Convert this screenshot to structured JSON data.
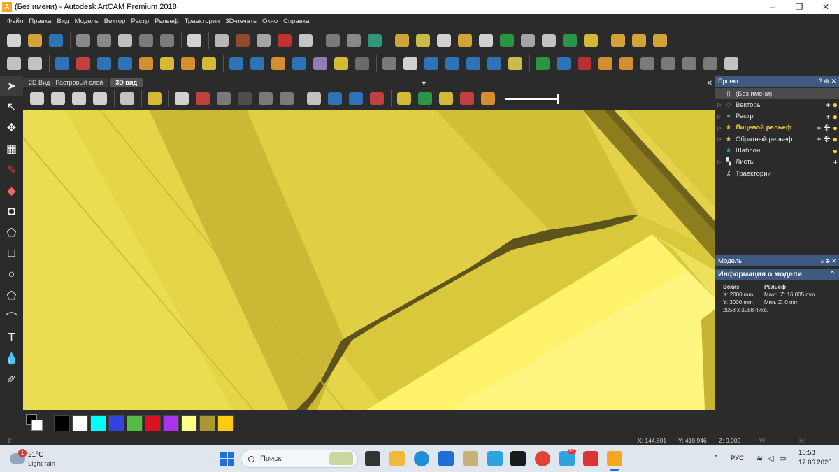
{
  "window": {
    "app_icon_letter": "A",
    "title": "(Без имени) - Autodesk ArtCAM Premium 2018",
    "controls": [
      "minimize-icon",
      "maximize-icon",
      "close-icon"
    ],
    "min_glyph": "–",
    "max_glyph": "❐",
    "close_glyph": "✕"
  },
  "menu": [
    "Файл",
    "Правка",
    "Вид",
    "Модель",
    "Вектор",
    "Растр",
    "Рельеф",
    "Траектория",
    "3D-печать",
    "Окно",
    "Справка"
  ],
  "toolbar1": {
    "icons": [
      {
        "name": "new-file-icon",
        "color": "#f2f2f2"
      },
      {
        "name": "open-folder-icon",
        "color": "#f0b93a"
      },
      {
        "name": "save-icon",
        "color": "#2f7fd0"
      },
      {
        "name": "sep"
      },
      {
        "name": "cut-icon",
        "color": "#9a9a9a"
      },
      {
        "name": "copy-icon",
        "color": "#9a9a9a"
      },
      {
        "name": "paste-icon",
        "color": "#d9d9d9"
      },
      {
        "name": "undo-icon",
        "color": "#8a8a8a"
      },
      {
        "name": "redo-icon",
        "color": "#8a8a8a"
      },
      {
        "name": "sep"
      },
      {
        "name": "notes-icon",
        "color": "#f0f0f0"
      },
      {
        "name": "sep"
      },
      {
        "name": "dimension-icon",
        "color": "#d0d0d0"
      },
      {
        "name": "layers-icon",
        "color": "#a0522d"
      },
      {
        "name": "grid-icon",
        "color": "#bbbbbb"
      },
      {
        "name": "flag-icon",
        "color": "#d33"
      },
      {
        "name": "measure-icon",
        "color": "#e0e0e0"
      },
      {
        "name": "sep"
      },
      {
        "name": "node-edit-icon",
        "color": "#888"
      },
      {
        "name": "transform-icon",
        "color": "#999"
      },
      {
        "name": "color-select-icon",
        "color": "#3a8"
      },
      {
        "name": "sep"
      },
      {
        "name": "folder-star-icon",
        "color": "#f0b93a"
      },
      {
        "name": "chevron-right-icon",
        "color": "#e8d44d"
      },
      {
        "name": "spark-icon",
        "color": "#eee"
      },
      {
        "name": "curve-icon",
        "color": "#f0b93a"
      },
      {
        "name": "star-burst-icon",
        "color": "#eee"
      },
      {
        "name": "relief-green-icon",
        "color": "#2aa84a"
      },
      {
        "name": "relief-stack-icon",
        "color": "#bbb"
      },
      {
        "name": "frame-icon",
        "color": "#ddd"
      },
      {
        "name": "green-grid-icon",
        "color": "#2aa84a"
      },
      {
        "name": "yellow-stack-icon",
        "color": "#f2d23a"
      },
      {
        "name": "sep"
      },
      {
        "name": "vector-dots-icon",
        "color": "#f0b93a"
      },
      {
        "name": "dashed-line-icon",
        "color": "#f0b93a"
      },
      {
        "name": "polyline-icon",
        "color": "#f0b93a"
      }
    ]
  },
  "toolbar2": {
    "icons": [
      {
        "name": "snap-icon",
        "color": "#ddd"
      },
      {
        "name": "target-icon",
        "color": "#ddd"
      },
      {
        "name": "sep"
      },
      {
        "name": "blue-diamond-icon",
        "color": "#2f7fd0"
      },
      {
        "name": "red-pill-icon",
        "color": "#d44"
      },
      {
        "name": "blue-extrude-icon",
        "color": "#2f7fd0"
      },
      {
        "name": "blue-spin-icon",
        "color": "#2f7fd0"
      },
      {
        "name": "waffle-icon",
        "color": "#f0a030"
      },
      {
        "name": "yellow-block-icon",
        "color": "#f2d23a"
      },
      {
        "name": "orange-block-icon",
        "color": "#f0a030"
      },
      {
        "name": "star-shape-icon",
        "color": "#f2d23a"
      },
      {
        "name": "sep"
      },
      {
        "name": "blue-plate-icon",
        "color": "#2f7fd0"
      },
      {
        "name": "blue-split-icon",
        "color": "#2f7fd0"
      },
      {
        "name": "stripe-icon",
        "color": "#f0a030"
      },
      {
        "name": "blue-up-icon",
        "color": "#2f7fd0"
      },
      {
        "name": "purple-stack-icon",
        "color": "#a38bd0"
      },
      {
        "name": "yellow-down-icon",
        "color": "#f2d23a"
      },
      {
        "name": "gray-tilt-icon",
        "color": "#777"
      },
      {
        "name": "sep"
      },
      {
        "name": "tool-icon",
        "color": "#888"
      },
      {
        "name": "white-tilt-icon",
        "color": "#eee"
      },
      {
        "name": "blue-stack-icon",
        "color": "#2f7fd0"
      },
      {
        "name": "blue-flat-icon",
        "color": "#2f7fd0"
      },
      {
        "name": "blue-drill-icon",
        "color": "#2f7fd0"
      },
      {
        "name": "blue-bowl-icon",
        "color": "#2f7fd0"
      },
      {
        "name": "book-stack-icon",
        "color": "#e8d44d"
      },
      {
        "name": "sep"
      },
      {
        "name": "plus-green-icon",
        "color": "#2aa84a"
      },
      {
        "name": "blue-pot-icon",
        "color": "#2f7fd0"
      },
      {
        "name": "red-ring-icon",
        "color": "#c33"
      },
      {
        "name": "merge-arrow-icon",
        "color": "#f0a030"
      },
      {
        "name": "half-shape-icon",
        "color": "#f0a030"
      },
      {
        "name": "dotted-square-icon",
        "color": "#888"
      },
      {
        "name": "dotted-corner-icon",
        "color": "#888"
      },
      {
        "name": "fillet-icon",
        "color": "#888"
      },
      {
        "name": "round-rect-icon",
        "color": "#888"
      },
      {
        "name": "dot-square-icon",
        "color": "#ddd"
      }
    ]
  },
  "view": {
    "tabs": [
      "2D Вид - Растровый слой",
      "3D вид"
    ],
    "active_tab": "3D вид",
    "pin_glyph": "▾",
    "close_glyph": "✕",
    "toolbar_icons": [
      {
        "name": "cube-red-icon",
        "color": "#eee"
      },
      {
        "name": "cube-front-icon",
        "color": "#eee"
      },
      {
        "name": "cube-side-icon",
        "color": "#eee"
      },
      {
        "name": "cube-iso-icon",
        "color": "#eee"
      },
      {
        "name": "sep"
      },
      {
        "name": "zoom-icon",
        "color": "#ddd"
      },
      {
        "name": "sep"
      },
      {
        "name": "light-bulb-icon",
        "color": "#f2d23a"
      },
      {
        "name": "sep"
      },
      {
        "name": "plane-icon",
        "color": "#eee"
      },
      {
        "name": "axes-icon",
        "color": "#d44"
      },
      {
        "name": "puzzle-icon",
        "color": "#888"
      },
      {
        "name": "cylinder-icon",
        "color": "#555"
      },
      {
        "name": "gray-plate-icon",
        "color": "#888"
      },
      {
        "name": "gray-tool-icon",
        "color": "#888"
      },
      {
        "name": "sep"
      },
      {
        "name": "clock-view-icon",
        "color": "#ddd"
      },
      {
        "name": "blue-star-icon",
        "color": "#2f7fd0"
      },
      {
        "name": "blue-layer-icon",
        "color": "#2f7fd0"
      },
      {
        "name": "red-layer-icon",
        "color": "#d44"
      },
      {
        "name": "sep"
      },
      {
        "name": "yellow-layer-icon",
        "color": "#f2d23a"
      },
      {
        "name": "green-circle-icon",
        "color": "#2aa84a"
      },
      {
        "name": "magic-icon",
        "color": "#f2d23a"
      },
      {
        "name": "rgb-pyramid-icon",
        "color": "#d44"
      },
      {
        "name": "rainbow-icon",
        "color": "#f0a030"
      }
    ],
    "zoom_level": 1.0
  },
  "left_tools": [
    {
      "name": "select-arrow-icon",
      "glyph": "➤"
    },
    {
      "name": "node-select-icon",
      "glyph": "↖"
    },
    {
      "name": "move-icon",
      "glyph": "✥"
    },
    {
      "name": "mesh-icon",
      "glyph": "▦"
    },
    {
      "name": "pencil-icon",
      "glyph": "✎"
    },
    {
      "name": "eraser-icon",
      "glyph": "◆"
    },
    {
      "name": "shape-edit-icon",
      "glyph": "◘"
    },
    {
      "name": "polyline-tool-icon",
      "glyph": "⬠"
    },
    {
      "name": "rectangle-icon",
      "glyph": "□"
    },
    {
      "name": "circle-icon",
      "glyph": "○"
    },
    {
      "name": "polygon-icon",
      "glyph": "⬠"
    },
    {
      "name": "arc-icon",
      "glyph": "⌒"
    },
    {
      "name": "text-icon",
      "glyph": "T"
    },
    {
      "name": "drop-icon",
      "glyph": "💧"
    },
    {
      "name": "brush-icon",
      "glyph": "✐"
    }
  ],
  "palette": {
    "colors": [
      "#000000",
      "#ffffff",
      "#00ffff",
      "#3344dd",
      "#55bb44",
      "#dd1122",
      "#aa33ee",
      "#ffff88",
      "#aa9933",
      "#ffcc11"
    ],
    "expand_glyph": "⇵"
  },
  "status": {
    "x": "X: 144.801",
    "y": "Y: 410.946",
    "z": "Z: 0.000",
    "w": "W:",
    "h": "H:"
  },
  "project": {
    "title": "Проект",
    "ctrls": "? ⊕ ✕",
    "items": [
      {
        "label": "(Без имени)",
        "icon": "document-icon",
        "glyph": "▯",
        "arrow": ""
      },
      {
        "label": "Векторы",
        "icon": "vectors-icon",
        "glyph": "◌",
        "arrow": "▷"
      },
      {
        "label": "Растр",
        "icon": "raster-icon",
        "glyph": "●",
        "arrow": "▷"
      },
      {
        "label": "Лицевой рельеф",
        "icon": "star-icon",
        "glyph": "★",
        "arrow": "▷"
      },
      {
        "label": "Обратный рельеф",
        "icon": "star-icon",
        "glyph": "★",
        "arrow": "▷"
      },
      {
        "label": "Шаблон",
        "icon": "star-blue-icon",
        "glyph": "★",
        "arrow": ""
      },
      {
        "label": "Листы",
        "icon": "sheets-icon",
        "glyph": "▚",
        "arrow": "▷"
      },
      {
        "label": "Траектории",
        "icon": "drill-icon",
        "glyph": "⚷",
        "arrow": ""
      }
    ]
  },
  "model": {
    "head": "Модель",
    "head_ctrls": "⌂ ⊕ ✕",
    "info_title": "Информация о модели",
    "info_ctrl": "⌃",
    "sketch_label": "Эскиз",
    "relief_label": "Рельеф",
    "x_size": "X: 2000 mm",
    "y_size": "Y: 3000 mm",
    "pixels": "2058 x 3088 пикс.",
    "max_z": "Макс. Z: 16.005 mm",
    "min_z": "Мин. Z: 0 mm"
  },
  "taskbar": {
    "weather_badge": "1",
    "temp": "21°C",
    "condition": "Light rain",
    "search_placeholder": "Поиск",
    "lang": "РУС",
    "time": "15:58",
    "date": "17.06.2025",
    "up_glyph": "⌃",
    "telegram_badge": "67",
    "apps": [
      {
        "name": "task-view-icon",
        "color": "#333"
      },
      {
        "name": "file-explorer-icon",
        "color": "#f0b93a"
      },
      {
        "name": "edge-icon",
        "color": "#1f8fd6"
      },
      {
        "name": "store-icon",
        "color": "#1f6fd6"
      },
      {
        "name": "file-manager-icon",
        "color": "#c8b07a"
      },
      {
        "name": "telegram-icon",
        "color": "#2ea3dd"
      },
      {
        "name": "terminal-icon",
        "color": "#1b1b1b"
      },
      {
        "name": "chrome-icon",
        "color": "#e04436"
      },
      {
        "name": "telegram-badge-icon",
        "color": "#2ea3dd"
      },
      {
        "name": "remote-icon",
        "color": "#d33"
      },
      {
        "name": "artcam-icon",
        "color": "#f5a623"
      }
    ]
  }
}
